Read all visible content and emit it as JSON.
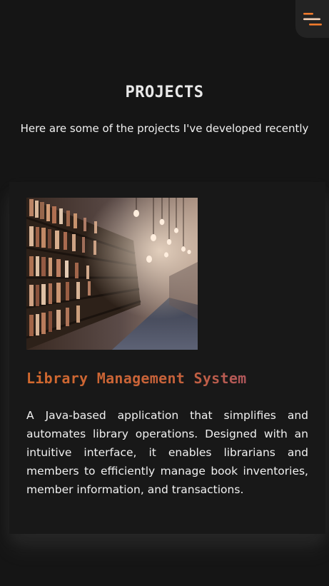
{
  "nav": {
    "menu_icon": "menu-lines-icon",
    "accent": "#f07a2c"
  },
  "projects": {
    "title": "PROJECTS",
    "subtitle": "Here are some of the projects I've developed recently",
    "items": [
      {
        "image_alt": "library-bookshelves-image",
        "title": "Library Management System",
        "description": "A Java-based application that simplifies and automates library operations. Designed with an intuitive interface, it enables librarians and members to efficiently manage book inventories, member information, and transactions."
      }
    ]
  },
  "colors": {
    "background": "#151515",
    "card": "#181818",
    "title_gradient_start": "#d2692e",
    "title_gradient_end": "#9a4c7d"
  }
}
